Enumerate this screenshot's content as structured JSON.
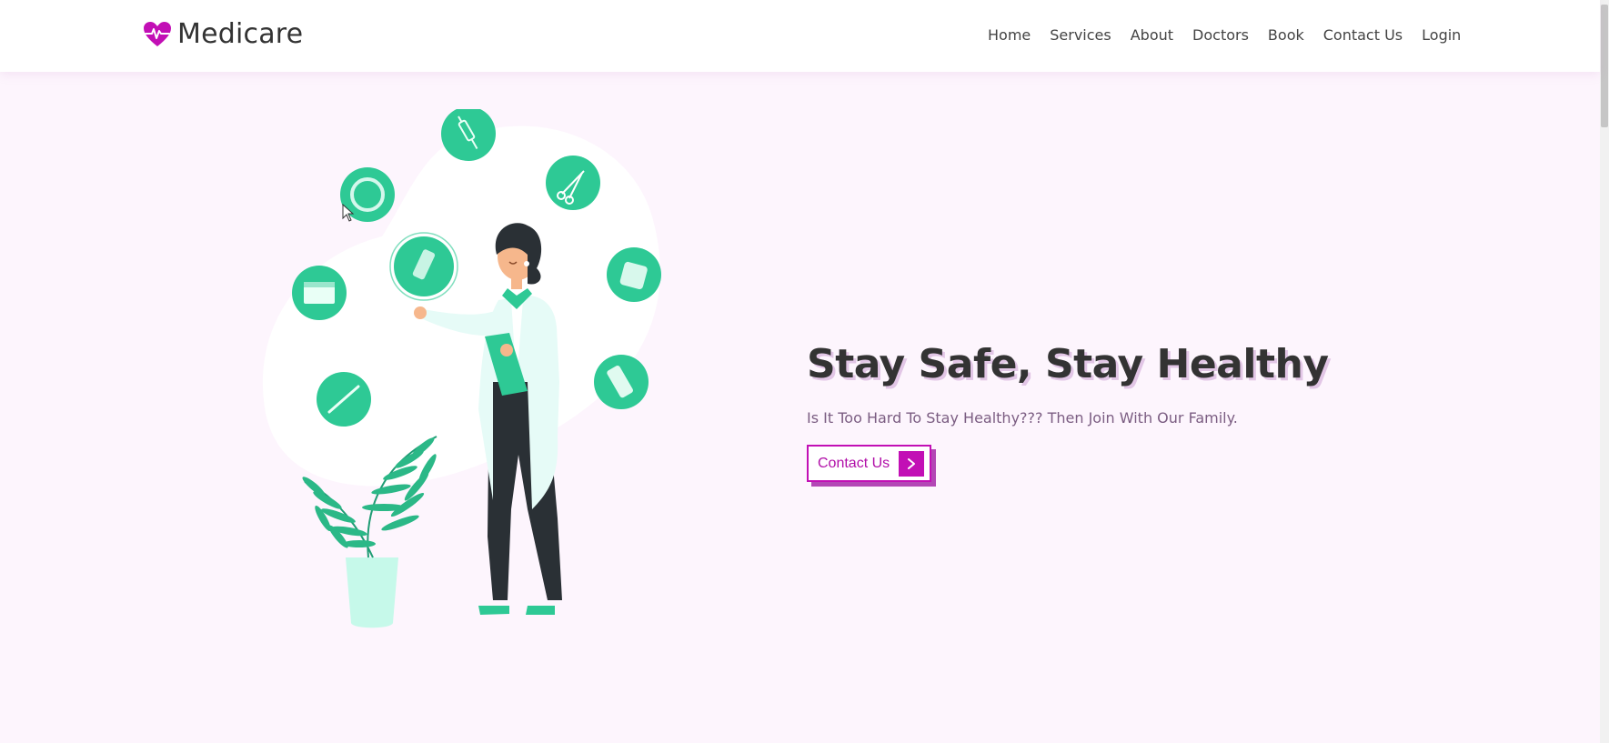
{
  "brand": {
    "name": "Medicare",
    "accent": "#c20fb5"
  },
  "nav": {
    "items": [
      "Home",
      "Services",
      "About",
      "Doctors",
      "Book",
      "Contact Us",
      "Login"
    ]
  },
  "hero": {
    "title": "Stay Safe, Stay Healthy",
    "subtitle": "Is It Too Hard To Stay Healthy??? Then Join With Our Family.",
    "cta_label": "Contact Us",
    "cta_icon": "chevron-right-icon"
  },
  "colors": {
    "background": "#fdf5fd",
    "illustration_green": "#2ec995",
    "text_dark": "#333333"
  }
}
